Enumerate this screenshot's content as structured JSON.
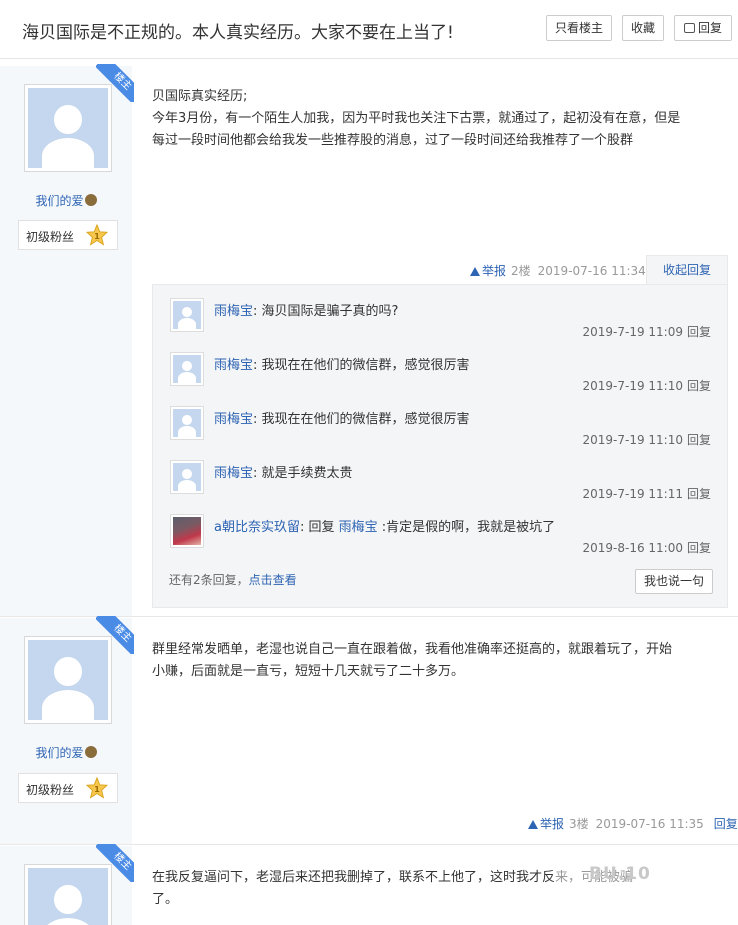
{
  "thread": {
    "title": "海贝国际是不正规的。本人真实经历。大家不要在上当了!",
    "buttons": {
      "only_author": "只看楼主",
      "favorite": "收藏",
      "reply": "回复"
    }
  },
  "posts": [
    {
      "ribbon": "楼主",
      "user": {
        "name": "我们的爱",
        "badge": "初级粉丝",
        "level": "1"
      },
      "lines": [
        "贝国际真实经历;",
        "今年3月份，有一个陌生人加我，因为平时我也关注下古票，就通过了，起初没有在意，但是",
        "每过一段时间他都会给我发一些推荐股的消息，过了一段时间还给我推荐了一个股群"
      ],
      "footer": {
        "report": "举报",
        "floor": "2楼",
        "time": "2019-07-16 11:34",
        "action": "收起回复"
      },
      "comments": [
        {
          "user": "雨梅宝",
          "sep": ": ",
          "text": "海贝国际是骗子真的吗?",
          "time": "2019-7-19 11:09",
          "reply": "回复"
        },
        {
          "user": "雨梅宝",
          "sep": ": ",
          "text": "我现在在他们的微信群，感觉很厉害",
          "time": "2019-7-19 11:10",
          "reply": "回复"
        },
        {
          "user": "雨梅宝",
          "sep": ": ",
          "text": "我现在在他们的微信群，感觉很厉害",
          "time": "2019-7-19 11:10",
          "reply": "回复"
        },
        {
          "user": "雨梅宝",
          "sep": ": ",
          "text": "就是手续费太贵",
          "time": "2019-7-19 11:11",
          "reply": "回复"
        },
        {
          "user": "a朝比奈实玖留",
          "sep": ": ",
          "reply_word": "回复",
          "reply_to": "雨梅宝",
          "sep2": " :",
          "text": "肯定是假的啊，我就是被坑了",
          "time": "2019-8-16 11:00",
          "reply": "回复"
        }
      ],
      "more": {
        "prefix": "还有2条回复，",
        "link": "点击查看"
      },
      "say_button": "我也说一句"
    },
    {
      "ribbon": "楼主",
      "user": {
        "name": "我们的爱",
        "badge": "初级粉丝",
        "level": "1"
      },
      "lines": [
        "群里经常发晒单，老湿也说自己一直在跟着做，我看他准确率还挺高的，就跟着玩了，开始",
        "小赚，后面就是一直亏，短短十几天就亏了二十多万。"
      ],
      "footer": {
        "report": "举报",
        "floor": "3楼",
        "time": "2019-07-16 11:35",
        "action": "回复"
      }
    },
    {
      "ribbon": "楼主",
      "lines": [
        "在我反复逼问下，老湿后来还把我删掉了，联系不上他了，这时我才反",
        "了。"
      ],
      "tail": "来，可能被骗"
    }
  ],
  "watermark": "BU.10"
}
